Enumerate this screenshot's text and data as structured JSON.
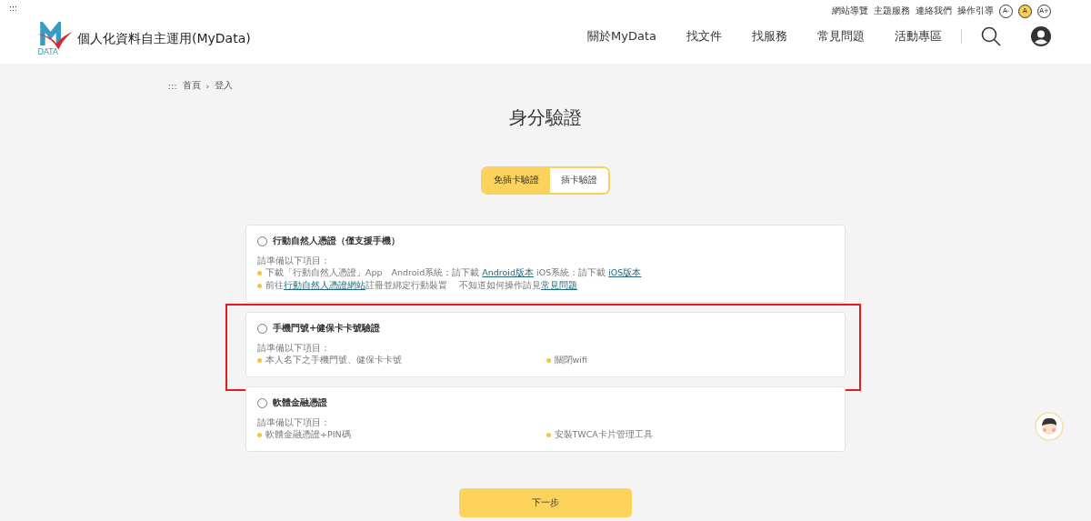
{
  "skip_link": ":::",
  "header": {
    "site_title": "個人化資料自主運用(MyData)",
    "logo_text": "DATA",
    "utility_links": [
      "網站導覽",
      "主題服務",
      "連絡我們",
      "操作引導"
    ],
    "font_sizes": [
      {
        "label": "A-",
        "selected": false
      },
      {
        "label": "A",
        "selected": true
      },
      {
        "label": "A+",
        "selected": false
      }
    ],
    "nav": [
      "關於MyData",
      "找文件",
      "找服務",
      "常見問題",
      "活動專區"
    ]
  },
  "breadcrumb": {
    "marker": ":::",
    "items": [
      "首頁",
      "登入"
    ],
    "separator": "›"
  },
  "page_title": "身分驗證",
  "tabs": [
    {
      "label": "免插卡驗證",
      "selected": true
    },
    {
      "label": "插卡驗證",
      "selected": false
    }
  ],
  "options": [
    {
      "title": "行動自然人憑證（僅支援手機）",
      "selected": false,
      "intro": "請準備以下項目：",
      "lines": [
        [
          {
            "kind": "text",
            "text": "下載「行動自然人憑證」App　Android系統：請下載 "
          },
          {
            "kind": "link",
            "text": "Android版本"
          },
          {
            "kind": "text",
            "text": " iOS系統：請下載 "
          },
          {
            "kind": "link",
            "text": "iOS版本"
          }
        ],
        [
          {
            "kind": "text",
            "text": "前往"
          },
          {
            "kind": "link",
            "text": "行動自然人憑證網站"
          },
          {
            "kind": "text",
            "text": "註冊並綁定行動裝置　 不知道如何操作請見"
          },
          {
            "kind": "link",
            "text": "常見問題"
          }
        ]
      ]
    },
    {
      "title": "手機門號+健保卡卡號驗證",
      "selected": false,
      "highlighted": true,
      "intro": "請準備以下項目：",
      "columns": [
        [
          {
            "kind": "text",
            "text": "本人名下之手機門號、健保卡卡號"
          }
        ],
        [
          {
            "kind": "text",
            "text": "關閉wifi"
          }
        ]
      ]
    },
    {
      "title": "軟體金融憑證",
      "selected": false,
      "intro": "請準備以下項目：",
      "columns": [
        [
          {
            "kind": "text",
            "text": "軟體金融憑證+PIN碼"
          }
        ],
        [
          {
            "kind": "text",
            "text": "安裝TWCA卡片管理工具"
          }
        ]
      ]
    }
  ],
  "next_button": "下一步"
}
